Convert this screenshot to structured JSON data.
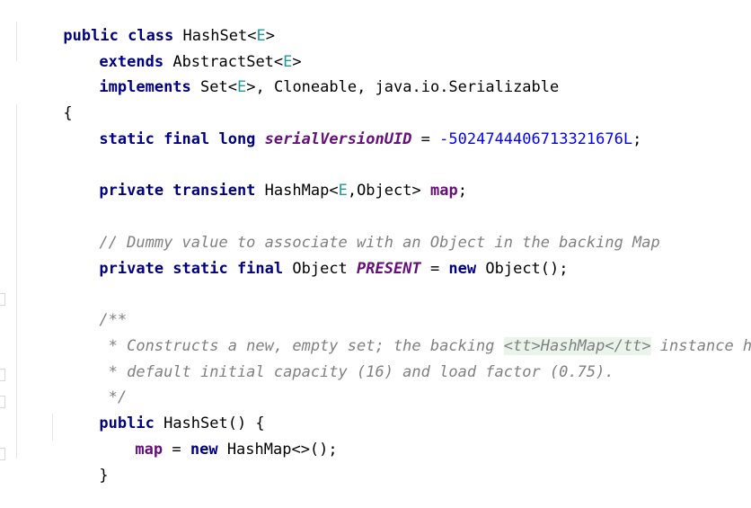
{
  "code": {
    "line1": {
      "kw1": "public",
      "kw2": "class",
      "name": "HashSet",
      "open": "<",
      "tp": "E",
      "close": ">"
    },
    "line2": {
      "kw": "extends",
      "name": "AbstractSet",
      "open": "<",
      "tp": "E",
      "close": ">"
    },
    "line3": {
      "kw": "implements",
      "name": "Set",
      "open": "<",
      "tp": "E",
      "close": ">,",
      "rest": " Cloneable, java.io.Serializable"
    },
    "line4": {
      "brace": "{"
    },
    "line5": {
      "kw": "static final long",
      "field": "serialVersionUID",
      "eq": " = ",
      "num": "-5024744406713321676L",
      "semi": ";"
    },
    "line6": {
      "kw": "private transient",
      "type": "HashMap",
      "open": "<",
      "tp": "E",
      "rest": ",Object>",
      "field": "map",
      "semi": ";"
    },
    "line7": {
      "comment": "// Dummy value to associate with an Object in the backing Map"
    },
    "line8": {
      "kw": "private static final",
      "type": "Object",
      "field": "PRESENT",
      "eq": " = ",
      "kw2": "new",
      "rest": " Object();"
    },
    "line9": {
      "comment": "/**"
    },
    "line10": {
      "pre": " * Constructs a new, empty set; the backing ",
      "tag1": "<tt>",
      "mid": "HashMap",
      "tag2": "</tt>",
      "post": " instance has"
    },
    "line11": {
      "comment": " * default initial capacity (16) and load factor (0.75)."
    },
    "line12": {
      "comment": " */"
    },
    "line13": {
      "kw": "public",
      "rest": " HashSet() {"
    },
    "line14": {
      "field": "map",
      "eq": " = ",
      "kw": "new",
      "rest": " HashMap<>();"
    },
    "line15": {
      "brace": "}"
    }
  }
}
